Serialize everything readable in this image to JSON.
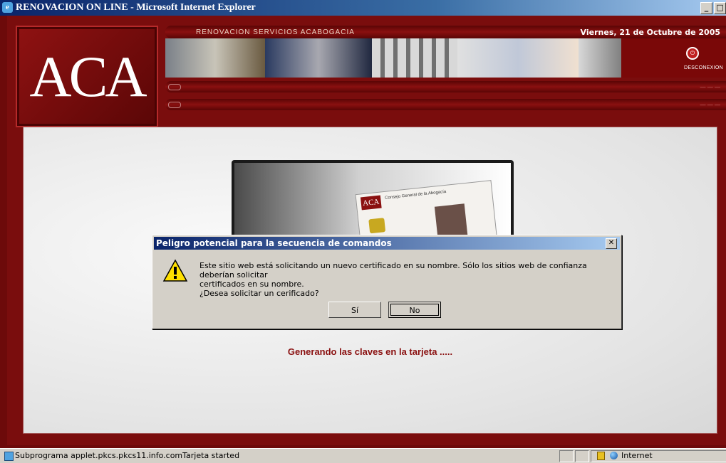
{
  "window": {
    "title": "RENOVACION ON LINE - Microsoft Internet Explorer",
    "minimize": "_",
    "maximize": "□"
  },
  "header": {
    "logo_text": "ACA",
    "label": "RENOVACION SERVICIOS ACABOGACIA",
    "date": "Viernes, 21 de Octubre de 2005",
    "disconnect_label": "DESCONEXION"
  },
  "card": {
    "logo": "ACA",
    "issuer": "Consejo General de la Abogacía"
  },
  "status_message": "Generando las claves en la tarjeta .....",
  "dialog": {
    "title": "Peligro potencial para la secuencia de comandos",
    "message_line1": "Este sitio web está solicitando un nuevo certificado en su nombre. Sólo los sitios web de confianza deberían solicitar",
    "message_line2": "certificados en su nombre.",
    "message_line3": "¿Desea solicitar un cerificado?",
    "yes_label": "Sí",
    "no_label": "No"
  },
  "statusbar": {
    "text": "Subprograma applet.pkcs.pkcs11.info.comTarjeta started",
    "zone": "Internet"
  },
  "colors": {
    "brand": "#7a0d0d",
    "title_bar": "#0a246a",
    "dialog_bg": "#d4d0c8"
  }
}
